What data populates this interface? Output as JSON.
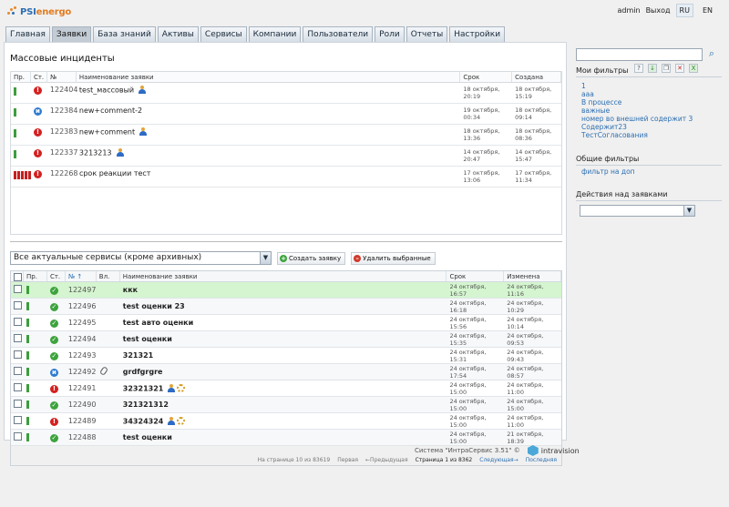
{
  "brand": {
    "name_a": "PSI",
    "name_b": "energo"
  },
  "top": {
    "user": "admin",
    "logout": "Выход",
    "langs": [
      "RU",
      "EN"
    ],
    "active_lang": "RU"
  },
  "tabs": [
    "Главная",
    "Заявки",
    "База знаний",
    "Активы",
    "Сервисы",
    "Компании",
    "Пользователи",
    "Роли",
    "Отчеты",
    "Настройки"
  ],
  "active_tab": "Заявки",
  "mass": {
    "title": "Массовые инциденты",
    "headers": [
      "Пр.",
      "Ст.",
      "№",
      "Наименование заявки",
      "Срок",
      "Создана"
    ],
    "rows": [
      {
        "prio": "single",
        "status": "red",
        "num": "122404",
        "name": "test_массовый",
        "person": true,
        "due1": "18 октября,",
        "due2": "20:19",
        "cr1": "18 октября,",
        "cr2": "15:19"
      },
      {
        "prio": "single",
        "status": "blue",
        "num": "122384",
        "name": "new+comment-2",
        "person": false,
        "due1": "19 октября,",
        "due2": "00:34",
        "cr1": "18 октября,",
        "cr2": "09:14"
      },
      {
        "prio": "single",
        "status": "red",
        "num": "122383",
        "name": "new+comment",
        "person": true,
        "due1": "18 октября,",
        "due2": "13:36",
        "cr1": "18 октября,",
        "cr2": "08:36"
      },
      {
        "prio": "single",
        "status": "red",
        "num": "122337",
        "name": "3213213",
        "person": true,
        "due1": "14 октября,",
        "due2": "20:47",
        "cr1": "14 октября,",
        "cr2": "15:47"
      },
      {
        "prio": "multi",
        "status": "red",
        "num": "122268",
        "name": "срок реакции тест",
        "person": false,
        "due1": "17 октября,",
        "due2": "13:06",
        "cr1": "17 октября,",
        "cr2": "11:34"
      }
    ]
  },
  "toolbar": {
    "service": "Все актуальные сервисы (кроме архивных)",
    "create": "Создать заявку",
    "delete": "Удалить выбранные"
  },
  "requests": {
    "headers": [
      "Пр.",
      "Ст.",
      "№ ↑",
      "Вл.",
      "Наименование заявки",
      "Срок",
      "Изменена"
    ],
    "rows": [
      {
        "status": "green",
        "num": "122497",
        "name": "ккк",
        "clip": false,
        "person": false,
        "cog": false,
        "due": "24 октября, 16:57",
        "chg": "24 октября, 11:16",
        "sel": true
      },
      {
        "status": "green",
        "num": "122496",
        "name": "test оценки 23",
        "clip": false,
        "person": false,
        "cog": false,
        "due": "24 октября, 16:18",
        "chg": "24 октября, 10:29",
        "sel": false
      },
      {
        "status": "green",
        "num": "122495",
        "name": "test авто оценки",
        "clip": false,
        "person": false,
        "cog": false,
        "due": "24 октября, 15:56",
        "chg": "24 октября, 10:14",
        "sel": false
      },
      {
        "status": "green",
        "num": "122494",
        "name": "test оценки",
        "clip": false,
        "person": false,
        "cog": false,
        "due": "24 октября, 15:35",
        "chg": "24 октября, 09:53",
        "sel": false
      },
      {
        "status": "green",
        "num": "122493",
        "name": "321321",
        "clip": false,
        "person": false,
        "cog": false,
        "due": "24 октября, 15:31",
        "chg": "24 октября, 09:43",
        "sel": false
      },
      {
        "status": "blue",
        "num": "122492",
        "name": "grdfgrgre",
        "clip": true,
        "person": false,
        "cog": false,
        "due": "24 октября, 17:54",
        "chg": "24 октября, 08:57",
        "sel": false
      },
      {
        "status": "red",
        "num": "122491",
        "name": "32321321",
        "clip": false,
        "person": true,
        "cog": true,
        "due": "24 октября, 15:00",
        "chg": "24 октября, 11:00",
        "sel": false
      },
      {
        "status": "green",
        "num": "122490",
        "name": "321321312",
        "clip": false,
        "person": false,
        "cog": false,
        "due": "24 октября, 15:00",
        "chg": "24 октября, 15:00",
        "sel": false
      },
      {
        "status": "red",
        "num": "122489",
        "name": "34324324",
        "clip": false,
        "person": true,
        "cog": true,
        "due": "24 октября, 15:00",
        "chg": "24 октября, 11:00",
        "sel": false
      },
      {
        "status": "green",
        "num": "122488",
        "name": "test оценки",
        "clip": false,
        "person": false,
        "cog": false,
        "due": "24 октября, 15:00",
        "chg": "21 октября, 18:39",
        "sel": false
      }
    ]
  },
  "pager": {
    "count": "На странице 10 из 83619",
    "first": "Первая",
    "prev": "←Предыдущая",
    "current": "Страница 1 из 8362",
    "next": "Следующая→",
    "last": "Последняя"
  },
  "footer": {
    "system": "Система \"ИнтраСервис 3.51\" ©",
    "vendor": "intravision"
  },
  "sidebar": {
    "my_filters": "Мои фильтры",
    "filters": [
      "1",
      "ааа",
      "В процессе",
      "важные",
      "номер во внешней содержит 3",
      "Содержит23",
      "ТестСогласования"
    ],
    "common_title": "Общие фильтры",
    "common": [
      "фильтр на доп"
    ],
    "actions_title": "Действия над заявками",
    "actions_value": ""
  },
  "colors": {
    "accent": "#2c6fb2",
    "status_red": "#d42020",
    "status_blue": "#2e7bd0",
    "status_green": "#3da33d",
    "selected_row": "#d4f5cf"
  }
}
